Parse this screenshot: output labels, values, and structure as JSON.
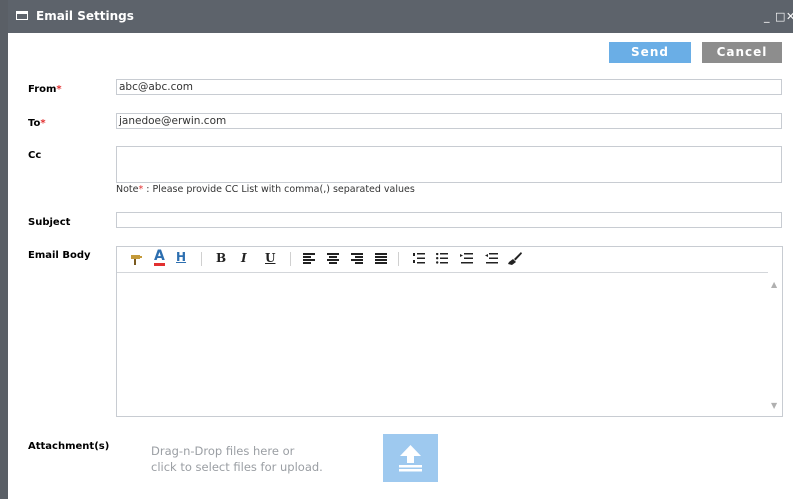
{
  "window": {
    "title": "Email Settings",
    "minimize": "_",
    "maximize": "□",
    "close": "✕"
  },
  "buttons": {
    "send": "Send",
    "cancel": "Cancel"
  },
  "form": {
    "from_label": "From",
    "from_value": "abc@abc.com",
    "to_label": "To",
    "to_value": "janedoe@erwin.com",
    "cc_label": "Cc",
    "cc_value": "",
    "note_prefix": "Note",
    "note_star": "*",
    "note_text": " : Please provide CC List with comma(,) separated values",
    "subject_label": "Subject",
    "subject_value": "",
    "body_label": "Email Body",
    "attachments_label": "Attachment(s)",
    "drop_line1": "Drag-n-Drop files here or",
    "drop_line2": "click to select files for upload."
  },
  "required_marker": "*",
  "toolbar": {
    "font_color": "A",
    "highlight": "H",
    "bold": "B",
    "italic": "I",
    "underline": "U"
  },
  "colors": {
    "titlebar": "#5d636b",
    "send_button": "#6aaee6",
    "cancel_button": "#8d8d8d",
    "upload_button": "#9ec9ef",
    "required": "#e23030"
  },
  "icons": [
    "window-icon",
    "paint-icon",
    "font-color-icon",
    "highlight-icon",
    "align-left-icon",
    "align-center-icon",
    "align-right-icon",
    "justify-icon",
    "ordered-list-icon",
    "bullet-list-icon",
    "indent-icon",
    "outdent-icon",
    "clear-format-icon",
    "upload-icon"
  ]
}
